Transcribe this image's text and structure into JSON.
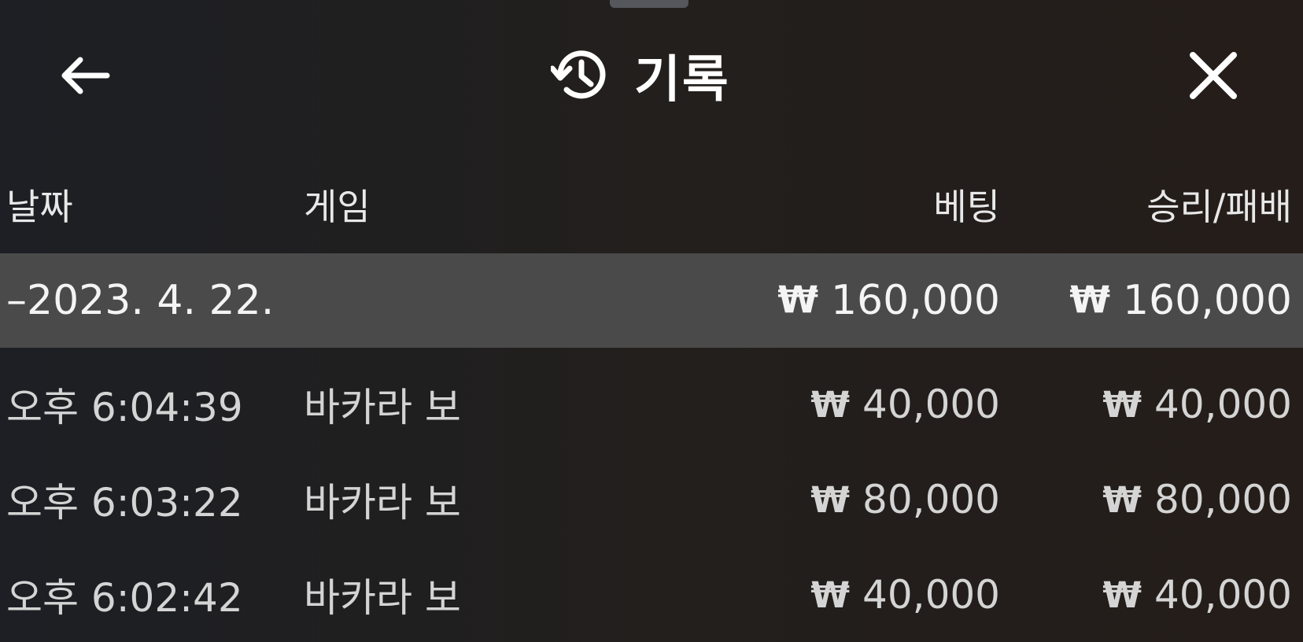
{
  "header": {
    "title": "기록",
    "back_icon": "arrow-left-icon",
    "history_icon": "history-clock-icon",
    "close_icon": "close-icon"
  },
  "table": {
    "columns": {
      "date": "날짜",
      "game": "게임",
      "bet": "베팅",
      "result": "승리/패배"
    },
    "group": {
      "date": "–2023. 4. 22.",
      "bet_currency": "₩",
      "bet": "160,000",
      "result_currency": "₩",
      "result": "160,000"
    },
    "rows": [
      {
        "time": "오후 6:04:39",
        "game": "바카라 보",
        "bet_currency": "₩",
        "bet": "40,000",
        "result_currency": "₩",
        "result": "40,000"
      },
      {
        "time": "오후 6:03:22",
        "game": "바카라 보",
        "bet_currency": "₩",
        "bet": "80,000",
        "result_currency": "₩",
        "result": "80,000"
      },
      {
        "time": "오후 6:02:42",
        "game": "바카라 보",
        "bet_currency": "₩",
        "bet": "40,000",
        "result_currency": "₩",
        "result": "40,000"
      }
    ]
  },
  "colors": {
    "background": "#221f1d",
    "group_row": "#4a4a4a",
    "text": "#f2f2f2"
  }
}
